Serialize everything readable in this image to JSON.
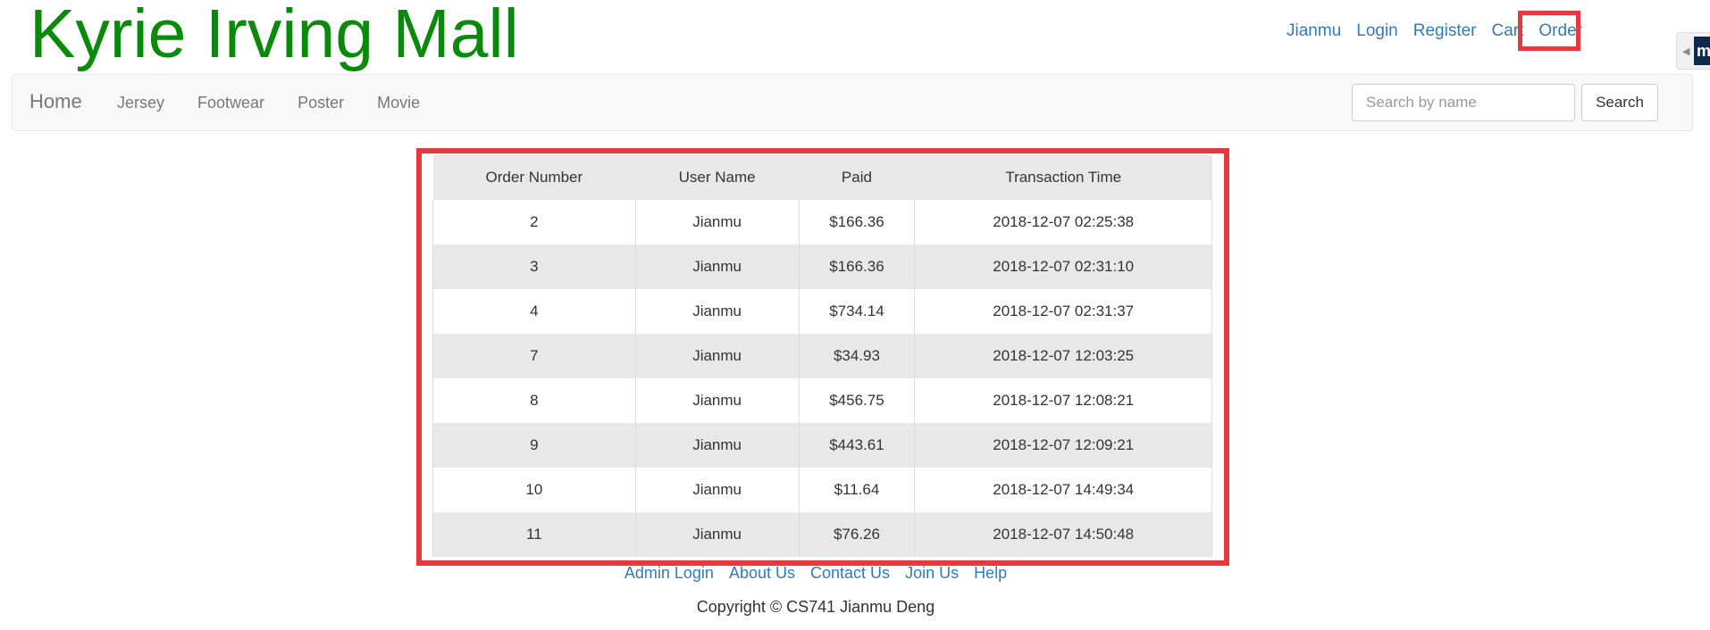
{
  "brand": {
    "title": "Kyrie Irving Mall"
  },
  "top_links": {
    "user": "Jianmu",
    "login": "Login",
    "register": "Register",
    "cart": "Cart",
    "order": "Order"
  },
  "navbar": {
    "home": "Home",
    "items": [
      "Jersey",
      "Footwear",
      "Poster",
      "Movie"
    ],
    "search": {
      "placeholder": "Search by name",
      "value": "",
      "button": "Search"
    }
  },
  "orders_table": {
    "headers": [
      "Order Number",
      "User Name",
      "Paid",
      "Transaction Time"
    ],
    "rows": [
      [
        "2",
        "Jianmu",
        "$166.36",
        "2018-12-07 02:25:38"
      ],
      [
        "3",
        "Jianmu",
        "$166.36",
        "2018-12-07 02:31:10"
      ],
      [
        "4",
        "Jianmu",
        "$734.14",
        "2018-12-07 02:31:37"
      ],
      [
        "7",
        "Jianmu",
        "$34.93",
        "2018-12-07 12:03:25"
      ],
      [
        "8",
        "Jianmu",
        "$456.75",
        "2018-12-07 12:08:21"
      ],
      [
        "9",
        "Jianmu",
        "$443.61",
        "2018-12-07 12:09:21"
      ],
      [
        "10",
        "Jianmu",
        "$11.64",
        "2018-12-07 14:49:34"
      ],
      [
        "11",
        "Jianmu",
        "$76.26",
        "2018-12-07 14:50:48"
      ]
    ]
  },
  "footer": {
    "links": [
      "Admin Login",
      "About Us",
      "Contact Us",
      "Join Us",
      "Help"
    ],
    "copyright": "Copyright © CS741 Jianmu Deng"
  },
  "side_widget": {
    "badge_text": "me",
    "icon": "chevron-left-icon"
  },
  "colors": {
    "brand": "#0a8a0a",
    "link": "#337ab7",
    "highlight": "#e8383f",
    "row_stripe": "#e8e8e8",
    "widget_badge": "#0d2a4d"
  }
}
